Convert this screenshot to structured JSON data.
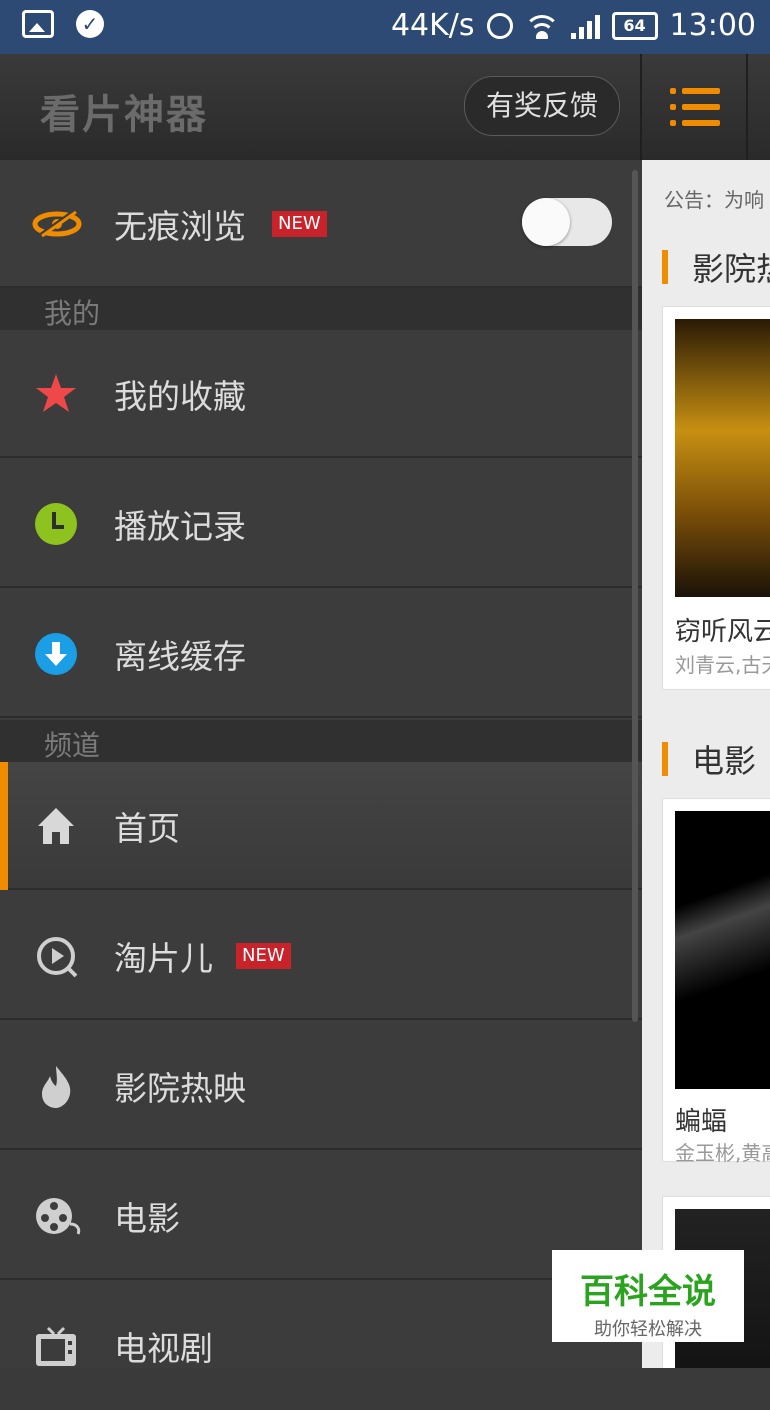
{
  "status_bar": {
    "speed": "44K/s",
    "battery": "64",
    "time": "13:00"
  },
  "header": {
    "title": "看片神器",
    "feedback_label": "有奖反馈"
  },
  "drawer": {
    "incognito": {
      "label": "无痕浏览",
      "badge": "NEW",
      "enabled": false
    },
    "section_mine": "我的",
    "mine_items": [
      {
        "label": "我的收藏",
        "icon": "star-icon"
      },
      {
        "label": "播放记录",
        "icon": "clock-icon"
      },
      {
        "label": "离线缓存",
        "icon": "download-icon"
      }
    ],
    "section_channels": "频道",
    "channel_items": [
      {
        "label": "首页",
        "icon": "home-icon",
        "active": true
      },
      {
        "label": "淘片儿",
        "icon": "play-search-icon",
        "badge": "NEW"
      },
      {
        "label": "影院热映",
        "icon": "flame-icon"
      },
      {
        "label": "电影",
        "icon": "film-reel-icon"
      },
      {
        "label": "电视剧",
        "icon": "tv-icon"
      }
    ]
  },
  "content": {
    "notice": "公告：为响",
    "sections": [
      {
        "title": "影院热",
        "card_title": "窃听风云",
        "card_cast": "刘青云,古天"
      },
      {
        "title": "电影",
        "card_title": "蝙蝠",
        "card_cast": "金玉彬,黄高"
      }
    ]
  },
  "watermark": {
    "main": "百科全说",
    "sub": "助你轻松解决"
  },
  "colors": {
    "accent": "#f08c00",
    "status_bar": "#2c4a73",
    "drawer_bg": "#3c3c3c"
  }
}
